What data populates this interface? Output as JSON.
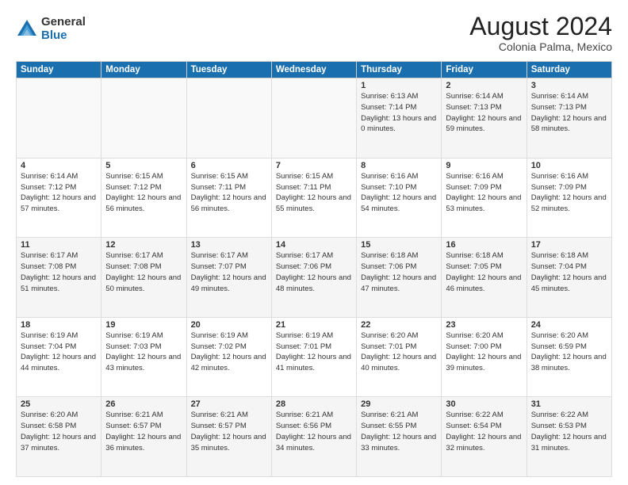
{
  "logo": {
    "general": "General",
    "blue": "Blue"
  },
  "title": "August 2024",
  "subtitle": "Colonia Palma, Mexico",
  "days_of_week": [
    "Sunday",
    "Monday",
    "Tuesday",
    "Wednesday",
    "Thursday",
    "Friday",
    "Saturday"
  ],
  "weeks": [
    [
      {
        "day": "",
        "sunrise": "",
        "sunset": "",
        "daylight": ""
      },
      {
        "day": "",
        "sunrise": "",
        "sunset": "",
        "daylight": ""
      },
      {
        "day": "",
        "sunrise": "",
        "sunset": "",
        "daylight": ""
      },
      {
        "day": "",
        "sunrise": "",
        "sunset": "",
        "daylight": ""
      },
      {
        "day": "1",
        "sunrise": "Sunrise: 6:13 AM",
        "sunset": "Sunset: 7:14 PM",
        "daylight": "Daylight: 13 hours and 0 minutes."
      },
      {
        "day": "2",
        "sunrise": "Sunrise: 6:14 AM",
        "sunset": "Sunset: 7:13 PM",
        "daylight": "Daylight: 12 hours and 59 minutes."
      },
      {
        "day": "3",
        "sunrise": "Sunrise: 6:14 AM",
        "sunset": "Sunset: 7:13 PM",
        "daylight": "Daylight: 12 hours and 58 minutes."
      }
    ],
    [
      {
        "day": "4",
        "sunrise": "Sunrise: 6:14 AM",
        "sunset": "Sunset: 7:12 PM",
        "daylight": "Daylight: 12 hours and 57 minutes."
      },
      {
        "day": "5",
        "sunrise": "Sunrise: 6:15 AM",
        "sunset": "Sunset: 7:12 PM",
        "daylight": "Daylight: 12 hours and 56 minutes."
      },
      {
        "day": "6",
        "sunrise": "Sunrise: 6:15 AM",
        "sunset": "Sunset: 7:11 PM",
        "daylight": "Daylight: 12 hours and 56 minutes."
      },
      {
        "day": "7",
        "sunrise": "Sunrise: 6:15 AM",
        "sunset": "Sunset: 7:11 PM",
        "daylight": "Daylight: 12 hours and 55 minutes."
      },
      {
        "day": "8",
        "sunrise": "Sunrise: 6:16 AM",
        "sunset": "Sunset: 7:10 PM",
        "daylight": "Daylight: 12 hours and 54 minutes."
      },
      {
        "day": "9",
        "sunrise": "Sunrise: 6:16 AM",
        "sunset": "Sunset: 7:09 PM",
        "daylight": "Daylight: 12 hours and 53 minutes."
      },
      {
        "day": "10",
        "sunrise": "Sunrise: 6:16 AM",
        "sunset": "Sunset: 7:09 PM",
        "daylight": "Daylight: 12 hours and 52 minutes."
      }
    ],
    [
      {
        "day": "11",
        "sunrise": "Sunrise: 6:17 AM",
        "sunset": "Sunset: 7:08 PM",
        "daylight": "Daylight: 12 hours and 51 minutes."
      },
      {
        "day": "12",
        "sunrise": "Sunrise: 6:17 AM",
        "sunset": "Sunset: 7:08 PM",
        "daylight": "Daylight: 12 hours and 50 minutes."
      },
      {
        "day": "13",
        "sunrise": "Sunrise: 6:17 AM",
        "sunset": "Sunset: 7:07 PM",
        "daylight": "Daylight: 12 hours and 49 minutes."
      },
      {
        "day": "14",
        "sunrise": "Sunrise: 6:17 AM",
        "sunset": "Sunset: 7:06 PM",
        "daylight": "Daylight: 12 hours and 48 minutes."
      },
      {
        "day": "15",
        "sunrise": "Sunrise: 6:18 AM",
        "sunset": "Sunset: 7:06 PM",
        "daylight": "Daylight: 12 hours and 47 minutes."
      },
      {
        "day": "16",
        "sunrise": "Sunrise: 6:18 AM",
        "sunset": "Sunset: 7:05 PM",
        "daylight": "Daylight: 12 hours and 46 minutes."
      },
      {
        "day": "17",
        "sunrise": "Sunrise: 6:18 AM",
        "sunset": "Sunset: 7:04 PM",
        "daylight": "Daylight: 12 hours and 45 minutes."
      }
    ],
    [
      {
        "day": "18",
        "sunrise": "Sunrise: 6:19 AM",
        "sunset": "Sunset: 7:04 PM",
        "daylight": "Daylight: 12 hours and 44 minutes."
      },
      {
        "day": "19",
        "sunrise": "Sunrise: 6:19 AM",
        "sunset": "Sunset: 7:03 PM",
        "daylight": "Daylight: 12 hours and 43 minutes."
      },
      {
        "day": "20",
        "sunrise": "Sunrise: 6:19 AM",
        "sunset": "Sunset: 7:02 PM",
        "daylight": "Daylight: 12 hours and 42 minutes."
      },
      {
        "day": "21",
        "sunrise": "Sunrise: 6:19 AM",
        "sunset": "Sunset: 7:01 PM",
        "daylight": "Daylight: 12 hours and 41 minutes."
      },
      {
        "day": "22",
        "sunrise": "Sunrise: 6:20 AM",
        "sunset": "Sunset: 7:01 PM",
        "daylight": "Daylight: 12 hours and 40 minutes."
      },
      {
        "day": "23",
        "sunrise": "Sunrise: 6:20 AM",
        "sunset": "Sunset: 7:00 PM",
        "daylight": "Daylight: 12 hours and 39 minutes."
      },
      {
        "day": "24",
        "sunrise": "Sunrise: 6:20 AM",
        "sunset": "Sunset: 6:59 PM",
        "daylight": "Daylight: 12 hours and 38 minutes."
      }
    ],
    [
      {
        "day": "25",
        "sunrise": "Sunrise: 6:20 AM",
        "sunset": "Sunset: 6:58 PM",
        "daylight": "Daylight: 12 hours and 37 minutes."
      },
      {
        "day": "26",
        "sunrise": "Sunrise: 6:21 AM",
        "sunset": "Sunset: 6:57 PM",
        "daylight": "Daylight: 12 hours and 36 minutes."
      },
      {
        "day": "27",
        "sunrise": "Sunrise: 6:21 AM",
        "sunset": "Sunset: 6:57 PM",
        "daylight": "Daylight: 12 hours and 35 minutes."
      },
      {
        "day": "28",
        "sunrise": "Sunrise: 6:21 AM",
        "sunset": "Sunset: 6:56 PM",
        "daylight": "Daylight: 12 hours and 34 minutes."
      },
      {
        "day": "29",
        "sunrise": "Sunrise: 6:21 AM",
        "sunset": "Sunset: 6:55 PM",
        "daylight": "Daylight: 12 hours and 33 minutes."
      },
      {
        "day": "30",
        "sunrise": "Sunrise: 6:22 AM",
        "sunset": "Sunset: 6:54 PM",
        "daylight": "Daylight: 12 hours and 32 minutes."
      },
      {
        "day": "31",
        "sunrise": "Sunrise: 6:22 AM",
        "sunset": "Sunset: 6:53 PM",
        "daylight": "Daylight: 12 hours and 31 minutes."
      }
    ]
  ]
}
